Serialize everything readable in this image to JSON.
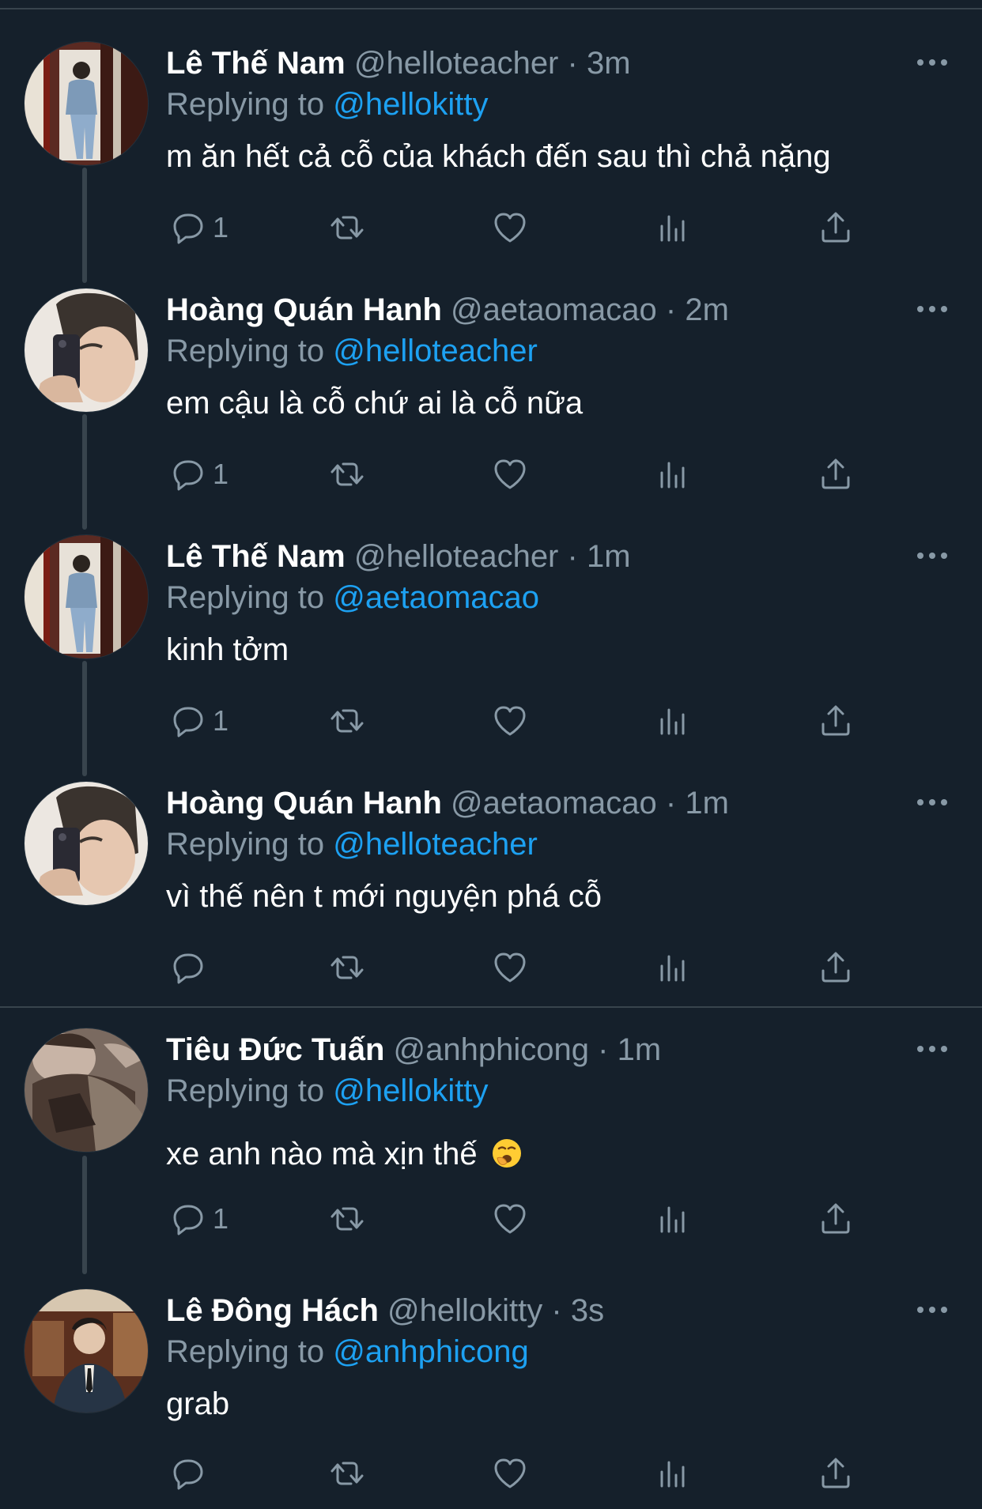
{
  "tweets": [
    {
      "name": "Lê Thế Nam",
      "handle": "@helloteacher",
      "sep": "·",
      "time": "3m",
      "replying_label": "Replying to",
      "replying_to": "@hellokitty",
      "text": "m ăn hết cả cỗ của khách đến sau thì chả nặng",
      "reply_count": "1",
      "avatar": "photo-mirror-selfie"
    },
    {
      "name": "Hoàng Quán Hanh",
      "handle": "@aetaomacao",
      "sep": "·",
      "time": "2m",
      "replying_label": "Replying to",
      "replying_to": "@helloteacher",
      "text": "em cậu là cỗ chứ ai là cỗ nữa",
      "reply_count": "1",
      "avatar": "photo-phone-selfie"
    },
    {
      "name": "Lê Thế Nam",
      "handle": "@helloteacher",
      "sep": "·",
      "time": "1m",
      "replying_label": "Replying to",
      "replying_to": "@aetaomacao",
      "text": "kinh tởm",
      "reply_count": "1",
      "avatar": "photo-mirror-selfie"
    },
    {
      "name": "Hoàng Quán Hanh",
      "handle": "@aetaomacao",
      "sep": "·",
      "time": "1m",
      "replying_label": "Replying to",
      "replying_to": "@helloteacher",
      "text": "vì thế nên t mới nguyện phá cỗ",
      "reply_count": "",
      "avatar": "photo-phone-selfie"
    },
    {
      "name": "Tiêu Đức Tuấn",
      "handle": "@anhphicong",
      "sep": "·",
      "time": "1m",
      "replying_label": "Replying to",
      "replying_to": "@hellokitty",
      "text": "xe anh nào mà xịn thế",
      "emoji": "yawning-face-emoji",
      "reply_count": "1",
      "avatar": "photo-leather-jacket"
    },
    {
      "name": "Lê Đông Hách",
      "handle": "@hellokitty",
      "sep": "·",
      "time": "3s",
      "replying_label": "Replying to",
      "replying_to": "@anhphicong",
      "text": "grab",
      "reply_count": "",
      "avatar": "photo-suit-portrait"
    }
  ],
  "theme": {
    "background": "#15202b",
    "divider": "#38444d",
    "text_primary": "#ffffff",
    "text_secondary": "#8899a6",
    "link": "#1da1f2"
  },
  "icons": [
    "more-icon",
    "reply-icon",
    "retweet-icon",
    "like-icon",
    "analytics-icon",
    "share-icon"
  ]
}
